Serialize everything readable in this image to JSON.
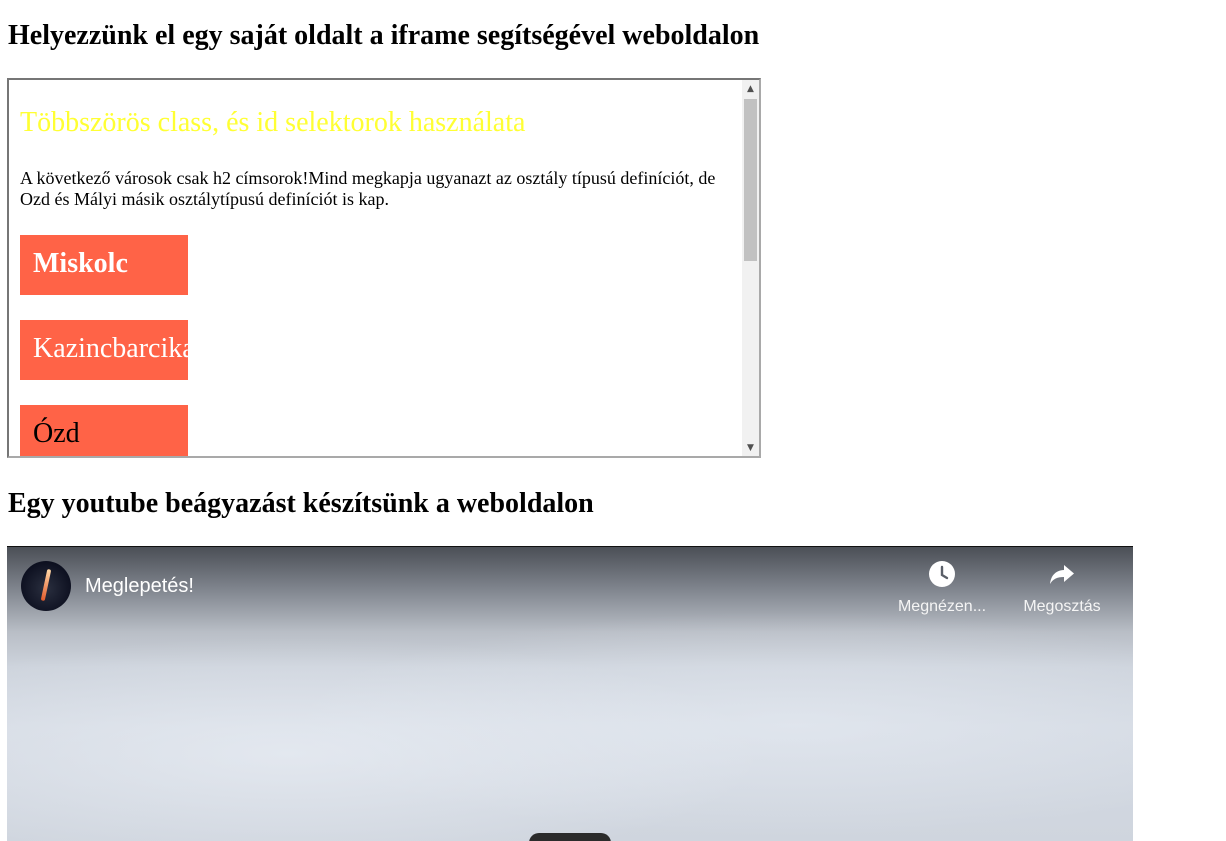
{
  "headings": {
    "iframe_section": "Helyezzünk el egy saját oldalt a iframe segítségével weboldalon",
    "youtube_section": "Egy youtube beágyazást készítsünk a weboldalon"
  },
  "iframe": {
    "title": "Többszörös class, és id selektorok használata",
    "paragraph": "A következő városok csak h2 címsorok!Mind megkapja ugyanazt az osztály típusú definíciót, de Ozd és Mályi másik osztálytípusú definíciót is kap.",
    "cities": [
      "Miskolc",
      "Kazincbarcika",
      "Ózd"
    ],
    "colors": {
      "title": "#ffff33",
      "city_background": "#ff6347"
    },
    "scrollbar": {
      "up_icon": "chevron-up-icon",
      "down_icon": "chevron-down-icon"
    }
  },
  "youtube": {
    "video_title": "Meglepetés!",
    "actions": {
      "watch_later": "Megnézen...",
      "share": "Megosztás"
    },
    "icons": {
      "watch_later": "clock-icon",
      "share": "share-arrow-icon",
      "channel": "channel-avatar"
    }
  }
}
